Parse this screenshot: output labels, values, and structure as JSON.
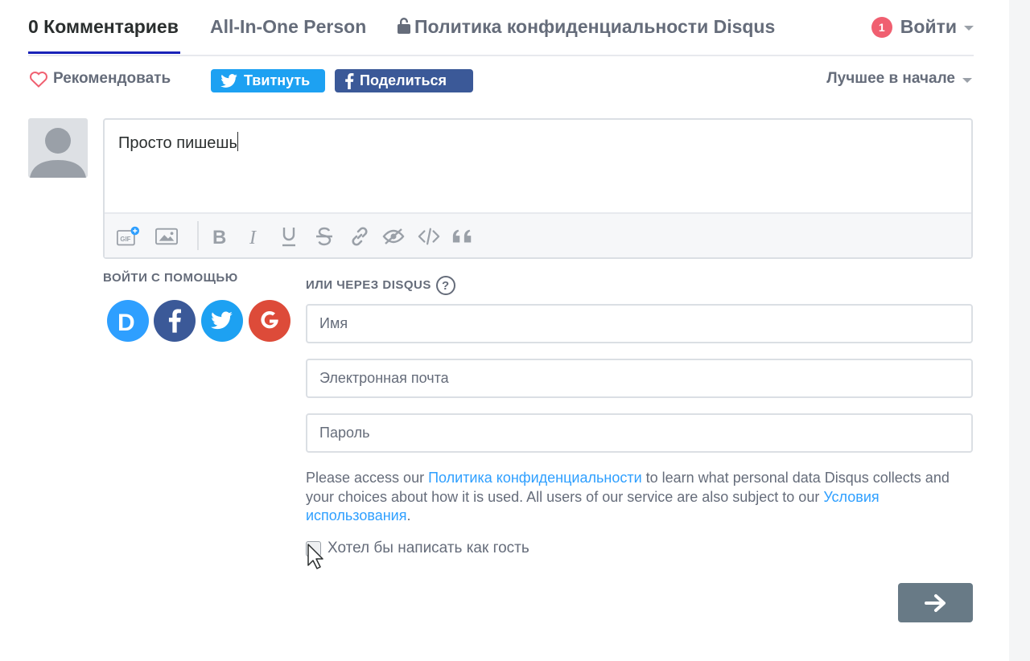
{
  "nav": {
    "comments_tab": "0 Комментариев",
    "community_tab": "All-In-One Person",
    "privacy_tab": "Политика конфиденциальности Disqus",
    "notification_count": "1",
    "login_label": "Войти"
  },
  "actions": {
    "recommend_label": "Рекомендовать",
    "tweet_label": "Твитнуть",
    "share_label": "Поделиться",
    "sort_label": "Лучшее в начале"
  },
  "composer": {
    "text": "Просто пишешь",
    "toolbar_icons": [
      "gif-icon",
      "image-icon",
      "bold-icon",
      "italic-icon",
      "underline-icon",
      "strikethrough-icon",
      "link-icon",
      "spoiler-icon",
      "code-icon",
      "quote-icon"
    ]
  },
  "login": {
    "social_heading": "ВОЙТИ С ПОМОЩЬЮ",
    "disqus_heading": "ИЛИ ЧЕРЕЗ DISQUS",
    "help_glyph": "?",
    "social_buttons": [
      {
        "name": "disqus",
        "letter": "D",
        "color": "#2e9fff"
      },
      {
        "name": "facebook",
        "letter": "f",
        "color": "#3b5998"
      },
      {
        "name": "twitter",
        "letter": "",
        "color": "#1da1f2"
      },
      {
        "name": "google",
        "letter": "G",
        "color": "#dd4b39"
      }
    ],
    "name_placeholder": "Имя",
    "email_placeholder": "Электронная почта",
    "password_placeholder": "Пароль"
  },
  "policy": {
    "text_1": "Please access our ",
    "privacy_link": "Политика конфиденциальности",
    "text_2": " to learn what personal data Disqus collects and your choices about how it is used. All users of our service are also subject to our ",
    "terms_link": "Условия использования",
    "text_3": "."
  },
  "guest": {
    "label": "Хотел бы написать как гость",
    "checked": false
  },
  "colors": {
    "accent": "#1922b8",
    "twitter": "#1da1f2",
    "facebook": "#3b5998",
    "link": "#2e9fff",
    "badge": "#f05f70",
    "submit": "#687a86"
  }
}
